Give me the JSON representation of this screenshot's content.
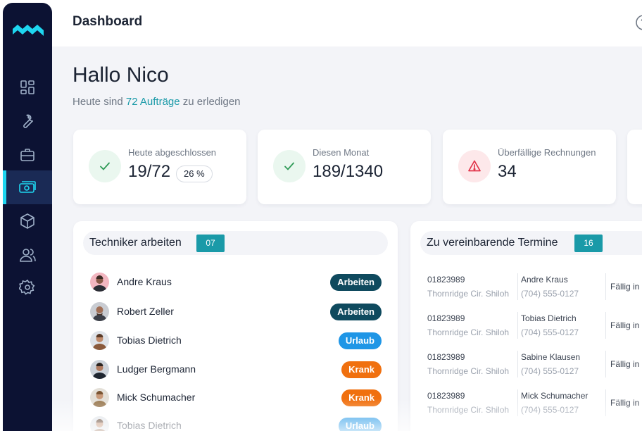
{
  "header": {
    "title": "Dashboard"
  },
  "greeting": {
    "title": "Hallo Nico",
    "prefix": "Heute sind",
    "highlight": "72 Aufträge",
    "suffix": "zu erledigen"
  },
  "stats": [
    {
      "label": "Heute abgeschlossen",
      "value": "19/72",
      "badge": "26 %",
      "status": "ok"
    },
    {
      "label": "Diesen Monat",
      "value": "189/1340",
      "status": "ok"
    },
    {
      "label": "Überfällige Rechnungen",
      "value": "34",
      "status": "warn"
    }
  ],
  "technicians": {
    "title": "Techniker arbeiten",
    "count": "07",
    "rows": [
      {
        "name": "Andre Kraus",
        "status": "Arbeiten"
      },
      {
        "name": "Robert Zeller",
        "status": "Arbeiten"
      },
      {
        "name": "Tobias Dietrich",
        "status": "Urlaub"
      },
      {
        "name": "Ludger Bergmann",
        "status": "Krank"
      },
      {
        "name": "Mick Schumacher",
        "status": "Krank"
      },
      {
        "name": "Tobias Dietrich",
        "status": "Urlaub"
      }
    ]
  },
  "appointments": {
    "title": "Zu vereinbarende Termine",
    "count": "16",
    "rows": [
      {
        "number": "01823989",
        "address": "Thornridge Cir. Shiloh",
        "name": "Andre Kraus",
        "phone": "(704) 555-0127",
        "due": "Fällig in"
      },
      {
        "number": "01823989",
        "address": "Thornridge Cir. Shiloh",
        "name": "Tobias Dietrich",
        "phone": "(704) 555-0127",
        "due": "Fällig in"
      },
      {
        "number": "01823989",
        "address": "Thornridge Cir. Shiloh",
        "name": "Sabine Klausen",
        "phone": "(704) 555-0127",
        "due": "Fällig in"
      },
      {
        "number": "01823989",
        "address": "Thornridge Cir. Shiloh",
        "name": "Mick Schumacher",
        "phone": "(704) 555-0127",
        "due": "Fällig in"
      }
    ]
  },
  "colors": {
    "sidebar": "#0c1233",
    "accent": "#1ed6f0",
    "teal": "#1a9aa8",
    "status_arbeiten": "#0f4a5e",
    "status_urlaub": "#1f96e6",
    "status_krank": "#f0700f",
    "warn": "#e2354a"
  },
  "icons": [
    "logo-icon",
    "dashboard-icon",
    "wrench-icon",
    "briefcase-icon",
    "money-icon",
    "box-icon",
    "users-icon",
    "gear-icon",
    "help-icon",
    "check-icon",
    "warning-icon"
  ]
}
